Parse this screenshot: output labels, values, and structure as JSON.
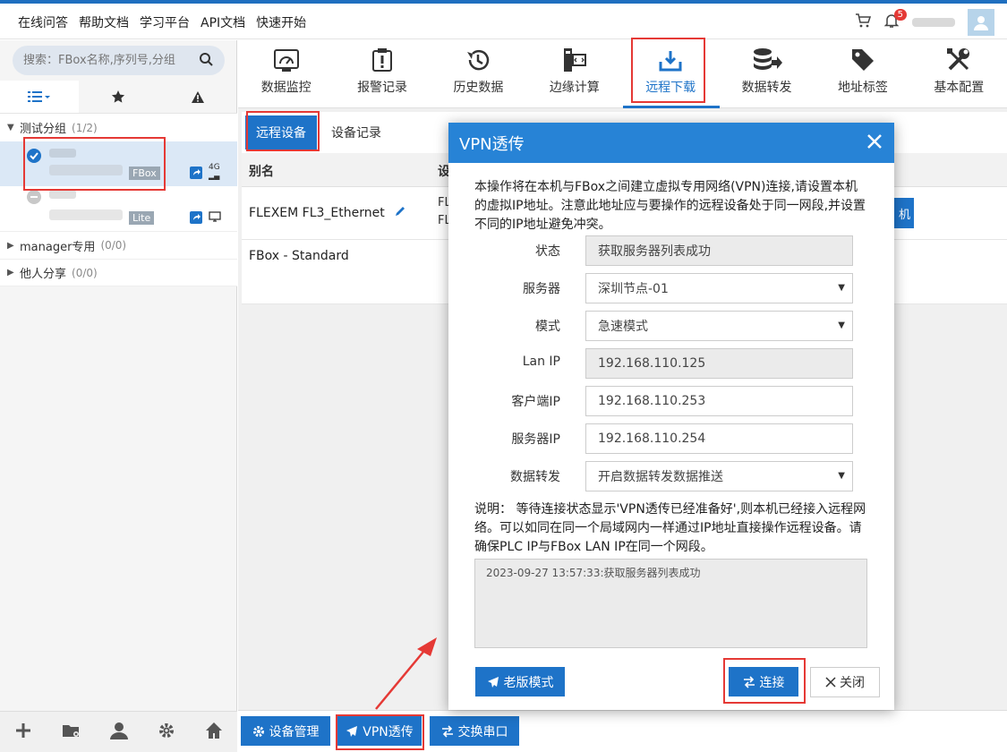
{
  "topbar": {
    "links": [
      "在线问答",
      "帮助文档",
      "学习平台",
      "API文档",
      "快速开始"
    ],
    "notification_count": "5"
  },
  "sidebar": {
    "search_placeholder": "搜索：FBox名称,序列号,分组",
    "groups": [
      {
        "name": "测试分组",
        "count": "(1/2)",
        "expanded": true
      },
      {
        "name": "manager专用",
        "count": "(0/0)",
        "expanded": false
      },
      {
        "name": "他人分享",
        "count": "(0/0)",
        "expanded": false
      }
    ],
    "devices": [
      {
        "tag": "FBox",
        "network": "4G",
        "status": "online"
      },
      {
        "tag": "Lite",
        "network": "lan",
        "status": "offline"
      }
    ]
  },
  "toolbar": {
    "items": [
      "数据监控",
      "报警记录",
      "历史数据",
      "边缘计算",
      "远程下载",
      "数据转发",
      "地址标签",
      "基本配置"
    ],
    "active": "远程下载"
  },
  "content": {
    "subtabs": [
      "远程设备",
      "设备记录"
    ],
    "table_headers": [
      "别名",
      "设"
    ],
    "rows": [
      {
        "name": "FLEXEM FL3_Ethernet",
        "col2a": "FL",
        "col2b": "FL",
        "btn_stub": "机"
      },
      {
        "name": "FBox - Standard"
      }
    ]
  },
  "bottom_bar": {
    "device_manage": "设备管理",
    "vpn": "VPN透传",
    "serial": "交换串口"
  },
  "modal": {
    "title": "VPN透传",
    "intro": "本操作将在本机与FBox之间建立虚拟专用网络(VPN)连接,请设置本机的虚拟IP地址。注意此地址应与要操作的远程设备处于同一网段,并设置不同的IP地址避免冲突。",
    "fields": [
      {
        "label": "状态",
        "value": "获取服务器列表成功",
        "readonly": true,
        "select": false
      },
      {
        "label": "服务器",
        "value": "深圳节点-01",
        "readonly": false,
        "select": true
      },
      {
        "label": "模式",
        "value": "急速模式",
        "readonly": false,
        "select": true
      },
      {
        "label": "Lan IP",
        "value": "192.168.110.125",
        "readonly": true,
        "select": false
      },
      {
        "label": "客户端IP",
        "value": "192.168.110.253",
        "readonly": false,
        "select": false
      },
      {
        "label": "服务器IP",
        "value": "192.168.110.254",
        "readonly": false,
        "select": false
      },
      {
        "label": "数据转发",
        "value": "开启数据转发数据推送",
        "readonly": false,
        "select": true
      }
    ],
    "note": "说明： 等待连接状态显示'VPN透传已经准备好',则本机已经接入远程网络。可以如同在同一个局域网内一样通过IP地址直接操作远程设备。请确保PLC IP与FBox LAN IP在同一个网段。",
    "log": "2023-09-27 13:57:33:获取服务器列表成功",
    "legacy_button": "老版模式",
    "connect_button": "连接",
    "close_button": "关闭"
  },
  "colors": {
    "primary": "#1e73c8",
    "header": "#2783d6",
    "highlight": "#e53935"
  }
}
